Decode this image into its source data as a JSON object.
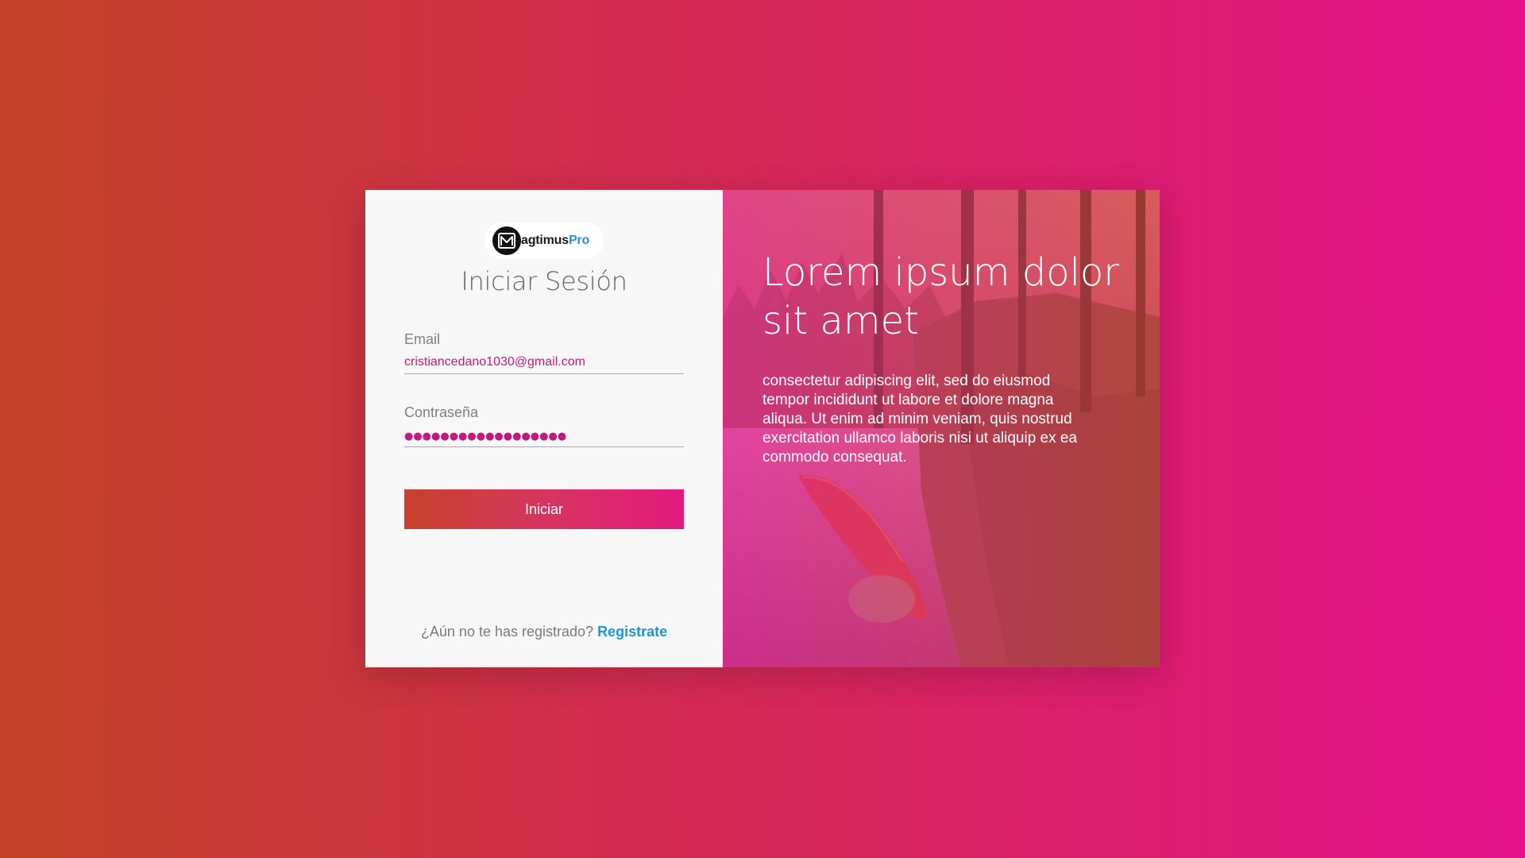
{
  "brand": {
    "logo_text": "agtimus",
    "logo_pro": "Pro",
    "logo_mark_icon": "m-monogram-icon"
  },
  "login": {
    "title": "Iniciar Sesión",
    "email_label": "Email",
    "email_value": "cristiancedano1030@gmail.com",
    "password_label": "Contraseña",
    "password_mask": "●●●●●●●●●●●●●●●●●●",
    "submit_label": "Iniciar",
    "register_prompt": "¿Aún no te has registrado?",
    "register_link": "Registrate"
  },
  "hero": {
    "title": "Lorem ipsum dolor sit amet",
    "text": "consectetur adipiscing elit, sed do eiusmod tempor incididunt ut labore et dolore magna aliqua. Ut enim ad minim veniam, quis nostrud exercitation ullamco laboris nisi ut aliquip ex ea commodo consequat."
  },
  "colors": {
    "bg_gradient_start": "#c44127",
    "bg_gradient_end": "#e4128a",
    "accent_pink": "#c2197e",
    "link_blue": "#1f95d4"
  }
}
